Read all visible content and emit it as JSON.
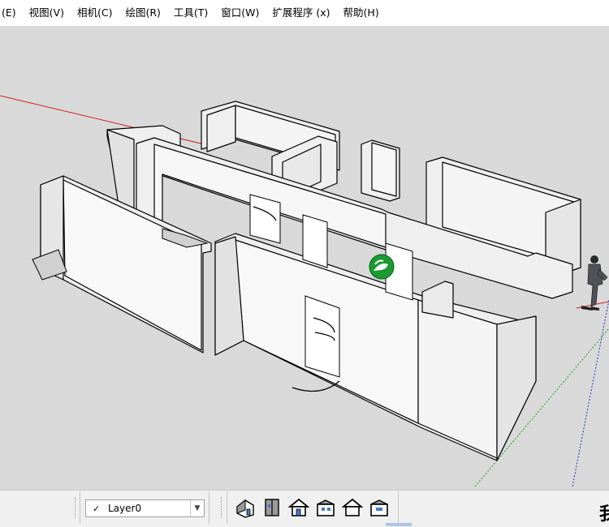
{
  "menubar": {
    "items": [
      {
        "label": "(E)"
      },
      {
        "label": "视图(V)"
      },
      {
        "label": "相机(C)"
      },
      {
        "label": "绘图(R)"
      },
      {
        "label": "工具(T)"
      },
      {
        "label": "窗口(W)"
      },
      {
        "label": "扩展程序 (x)"
      },
      {
        "label": "帮助(H)"
      }
    ]
  },
  "viewport": {
    "background_color": "#d9d9d9",
    "wall_color": "#efefef",
    "axis_colors": {
      "red": "#d02020",
      "green": "#20a020",
      "blue": "#2030c0"
    },
    "cursor_icon": "orbit-hand-icon"
  },
  "layers": {
    "selected_layer": "Layer0",
    "checked": "✓"
  },
  "views_toolbar": {
    "buttons": [
      {
        "name": "iso-view-button",
        "icon": "iso-house-icon"
      },
      {
        "name": "top-view-button",
        "icon": "top-house-icon"
      },
      {
        "name": "front-view-button",
        "icon": "front-house-icon"
      },
      {
        "name": "right-view-button",
        "icon": "right-house-icon"
      },
      {
        "name": "back-view-button",
        "icon": "back-house-icon"
      },
      {
        "name": "left-view-button",
        "icon": "left-house-icon"
      }
    ]
  },
  "edge_text": {
    "partial_glyph": "我"
  }
}
